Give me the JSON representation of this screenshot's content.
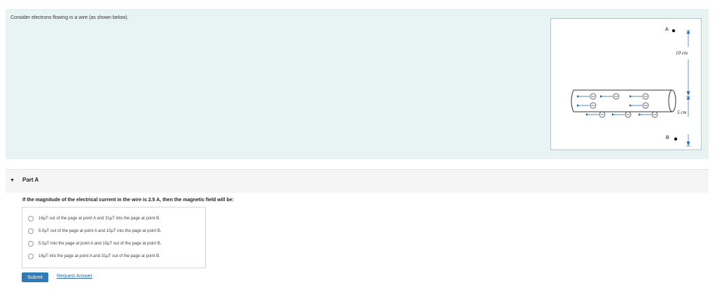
{
  "problem": {
    "prompt": "Consider electrons flowing in a wire (as shown below).",
    "figure": {
      "point_a": "A",
      "point_b": "B",
      "dist_top": "10 cm",
      "dist_bottom": "5 cm"
    }
  },
  "part": {
    "title": "Part A",
    "question": "If the magnitude of the electrical current in the wire is 2.5 A, then the magnetic field will be:",
    "choices": [
      "16μT out of the page at point A and 31μT into the page at point B.",
      "5.0μT out of the page at point A and 10μT into the page at point B.",
      "5.0μT into the page at point A and 10μT out of the page at point B.",
      "16μT into the page at point A and 31μT out of the page at point B."
    ],
    "submit_label": "Submit",
    "request_label": "Request Answer"
  }
}
